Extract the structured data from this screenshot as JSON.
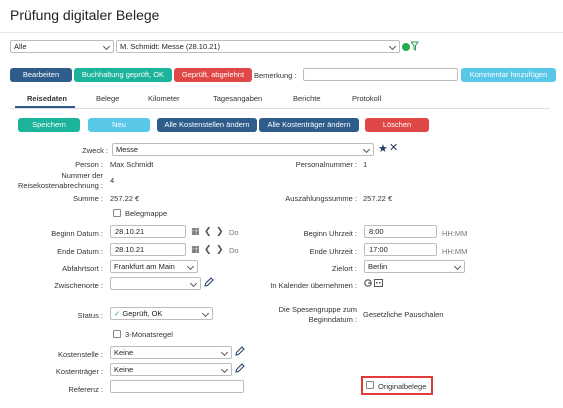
{
  "header": {
    "title": "Prüfung digitaler Belege"
  },
  "filter": {
    "status_select": "Alle",
    "trip_select": "M. Schmidt: Messe (28.10.21)"
  },
  "actions": {
    "edit": "Bearbeiten",
    "approved": "Buchhaltung geprüft, OK",
    "rejected": "Geprüft, abgelehnt",
    "remark_label": "Bemerkung :",
    "remark_value": "",
    "add_comment": "Kommentar hinzufügen"
  },
  "tabs": [
    "Reisedaten",
    "Belege",
    "Kilometer",
    "Tagesangaben",
    "Berichte",
    "Protokoll"
  ],
  "toolbar": {
    "save": "Speichern",
    "new": "Neu",
    "change_cost_centers": "Alle Kostenstellen ändern",
    "change_cost_bearers": "Alle Kostenträger ändern",
    "delete": "Löschen"
  },
  "form": {
    "zweck_label": "Zweck :",
    "zweck_value": "Messe",
    "person_label": "Person :",
    "person_value": "Max Schmidt",
    "personalnummer_label": "Personalnummer :",
    "personalnummer_value": "1",
    "nummer_label_1": "Nummer der",
    "nummer_label_2": "Reisekostenabrechnung :",
    "nummer_value": "4",
    "summe_label": "Summe :",
    "summe_value": "257.22 €",
    "auszahlung_label": "Auszahlungssumme :",
    "auszahlung_value": "257.22 €",
    "belegmappe_label": "Belegmappe",
    "beginn_datum_label": "Beginn Datum :",
    "beginn_datum_value": "28.10.21",
    "beginn_day": "Do",
    "ende_datum_label": "Ende Datum :",
    "ende_datum_value": "28.10.21",
    "ende_day": "Do",
    "beginn_uhrzeit_label": "Beginn Uhrzeit :",
    "beginn_uhrzeit_value": "8:00",
    "beginn_uhrzeit_format": "HH:MM",
    "ende_uhrzeit_label": "Ende Uhrzeit :",
    "ende_uhrzeit_value": "17:00",
    "ende_uhrzeit_format": "HH:MM",
    "abfahrtsort_label": "Abfahrtsort :",
    "abfahrtsort_value": "Frankfurt am Main",
    "zielort_label": "Zielort :",
    "zielort_value": "Berlin",
    "zwischenorte_label": "Zwischenorte :",
    "zwischenorte_value": "",
    "kalender_label": "In Kalender übernehmen :",
    "status_label": "Status :",
    "status_value": "Geprüft, OK",
    "spesen_label_1": "Die Spesengruppe zum",
    "spesen_label_2": "Beginndatum :",
    "spesen_value": "Gesetzliche Pauschalen",
    "monatsregel_label": "3-Monatsregel",
    "kostenstelle_label": "Kostenstelle :",
    "kostenstelle_value": "Keine",
    "kostentraeger_label": "Kostenträger :",
    "kostentraeger_value": "Keine",
    "referenz_label": "Referenz :",
    "referenz_value": "",
    "originalbelege_label": "Originalbelege"
  }
}
